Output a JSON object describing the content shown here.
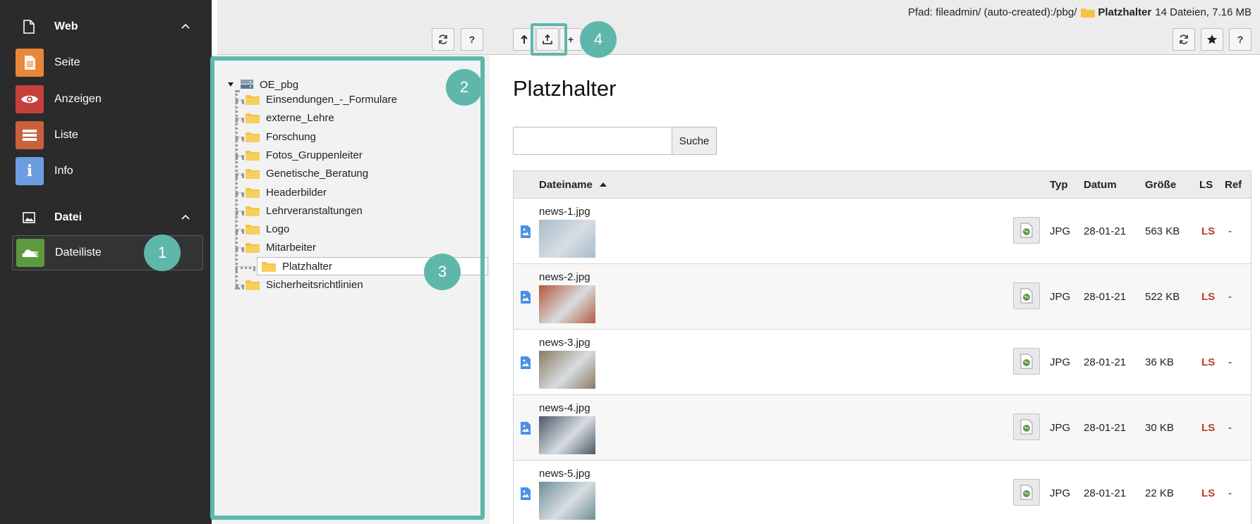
{
  "module_menu": {
    "groups": [
      {
        "label": "Web",
        "icon": "page-icon",
        "items": [
          {
            "label": "Seite",
            "icon": "page-module-icon",
            "color": "#e8873a"
          },
          {
            "label": "Anzeigen",
            "icon": "eye-icon",
            "color": "#c6403b"
          },
          {
            "label": "Liste",
            "icon": "list-icon",
            "color": "#c9613d"
          },
          {
            "label": "Info",
            "icon": "info-icon",
            "color": "#6d9de0"
          }
        ]
      },
      {
        "label": "Datei",
        "icon": "image-icon",
        "items": [
          {
            "label": "Dateiliste",
            "icon": "filelist-icon",
            "color": "#5d9a3f",
            "active": true
          }
        ]
      }
    ]
  },
  "path_bar": {
    "prefix": "Pfad: fileadmin/ (auto-created):/pbg/",
    "folder": "Platzhalter",
    "summary": "14 Dateien, 7.16 MB"
  },
  "tree_toolbar": {
    "refresh": "refresh-icon",
    "help_label": "?"
  },
  "main_toolbar": {
    "up": "up-arrow-icon",
    "upload": "upload-icon",
    "new_label": "+",
    "refresh": "refresh-icon",
    "bookmark": "star-icon",
    "help_label": "?"
  },
  "tree": {
    "root": "OE_pbg",
    "folders": [
      {
        "label": "Einsendungen_-_Formulare",
        "expandable": false
      },
      {
        "label": "externe_Lehre",
        "expandable": false
      },
      {
        "label": "Forschung",
        "expandable": true
      },
      {
        "label": "Fotos_Gruppenleiter",
        "expandable": true
      },
      {
        "label": "Genetische_Beratung",
        "expandable": false
      },
      {
        "label": "Headerbilder",
        "expandable": true
      },
      {
        "label": "Lehrveranstaltungen",
        "expandable": false
      },
      {
        "label": "Logo",
        "expandable": false
      },
      {
        "label": "Mitarbeiter",
        "expandable": true
      },
      {
        "label": "Platzhalter",
        "expandable": false,
        "selected": true
      },
      {
        "label": "Sicherheitsrichtlinien",
        "expandable": false
      }
    ]
  },
  "badges": [
    "1",
    "2",
    "3",
    "4"
  ],
  "main": {
    "title": "Platzhalter",
    "search_button": "Suche",
    "search_value": "",
    "columns": {
      "name": "Dateiname",
      "type": "Typ",
      "date": "Datum",
      "size": "Größe",
      "ls": "LS",
      "ref": "Ref"
    },
    "files": [
      {
        "name": "news-1.jpg",
        "type": "JPG",
        "date": "28-01-21",
        "size": "563 KB",
        "ls": "LS",
        "ref": "-",
        "thumb_color": "#a9bccb"
      },
      {
        "name": "news-2.jpg",
        "type": "JPG",
        "date": "28-01-21",
        "size": "522 KB",
        "ls": "LS",
        "ref": "-",
        "thumb_color": "#b45a3a"
      },
      {
        "name": "news-3.jpg",
        "type": "JPG",
        "date": "28-01-21",
        "size": "36 KB",
        "ls": "LS",
        "ref": "-",
        "thumb_color": "#8a7a62"
      },
      {
        "name": "news-4.jpg",
        "type": "JPG",
        "date": "28-01-21",
        "size": "30 KB",
        "ls": "LS",
        "ref": "-",
        "thumb_color": "#4b5866"
      },
      {
        "name": "news-5.jpg",
        "type": "JPG",
        "date": "28-01-21",
        "size": "22 KB",
        "ls": "LS",
        "ref": "-",
        "thumb_color": "#6e8f97"
      }
    ]
  },
  "colors": {
    "accent": "#5fb7ab",
    "menu_bg": "#2b2b2b",
    "ls_red": "#c0392b"
  }
}
